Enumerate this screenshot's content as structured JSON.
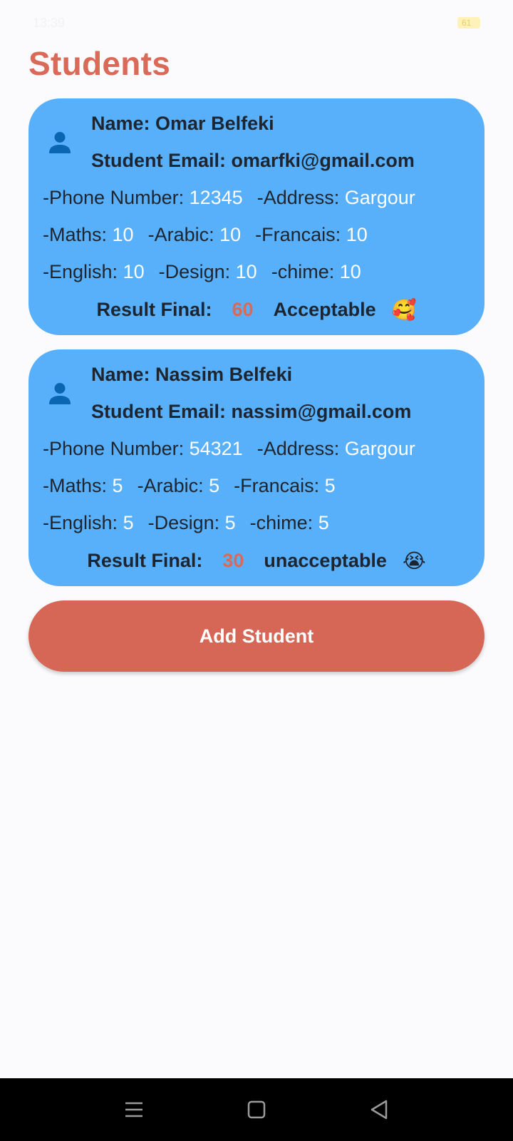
{
  "status_bar": {
    "time": "13:39",
    "battery": "61"
  },
  "page": {
    "title": "Students"
  },
  "students": [
    {
      "name_label": "Name: Omar Belfeki",
      "email_label": "Student Email: omarfki@gmail.com",
      "phone_key": "-Phone Number: ",
      "phone": "12345",
      "address_key": "-Address: ",
      "address": "Gargour",
      "maths_key": "-Maths: ",
      "maths": "10",
      "arabic_key": "-Arabic: ",
      "arabic": "10",
      "francais_key": "-Francais: ",
      "francais": "10",
      "english_key": "-English: ",
      "english": "10",
      "design_key": "-Design: ",
      "design": "10",
      "chime_key": "-chime: ",
      "chime": "10",
      "result_label": "Result Final:",
      "result_score": "60",
      "result_text": "Acceptable",
      "result_emoji": "🥰"
    },
    {
      "name_label": "Name: Nassim Belfeki",
      "email_label": "Student Email: nassim@gmail.com",
      "phone_key": "-Phone Number: ",
      "phone": "54321",
      "address_key": "-Address: ",
      "address": "Gargour",
      "maths_key": "-Maths: ",
      "maths": "5",
      "arabic_key": "-Arabic: ",
      "arabic": "5",
      "francais_key": "-Francais: ",
      "francais": "5",
      "english_key": "-English: ",
      "english": "5",
      "design_key": "-Design: ",
      "design": "5",
      "chime_key": "-chime: ",
      "chime": "5",
      "result_label": "Result Final:",
      "result_score": "30",
      "result_text": "unacceptable",
      "result_emoji": "😭"
    }
  ],
  "actions": {
    "add_student_label": "Add Student"
  },
  "colors": {
    "accent": "#d96a58",
    "card": "#58b0fb",
    "button": "#d66757",
    "icon": "#0a66b0"
  },
  "icons": {
    "avatar": "person-icon",
    "nav_menu": "menu-icon",
    "nav_home": "square-home-icon",
    "nav_back": "triangle-back-icon"
  }
}
